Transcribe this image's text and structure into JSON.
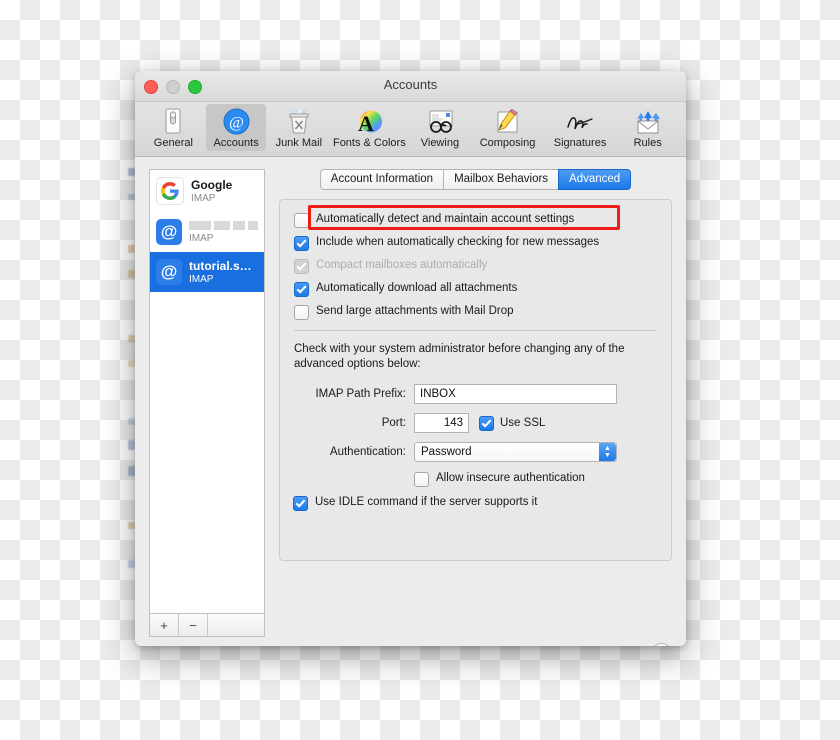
{
  "window": {
    "title": "Accounts",
    "traffic_lights": [
      "close-button",
      "minimize-button",
      "zoom-button"
    ]
  },
  "toolbar": {
    "items": [
      {
        "label": "General",
        "icon": "general-icon",
        "selected": false
      },
      {
        "label": "Accounts",
        "icon": "accounts-at-icon",
        "selected": true
      },
      {
        "label": "Junk Mail",
        "icon": "junk-mail-trash-icon",
        "selected": false
      },
      {
        "label": "Fonts & Colors",
        "icon": "fonts-colors-icon",
        "selected": false
      },
      {
        "label": "Viewing",
        "icon": "viewing-glasses-icon",
        "selected": false
      },
      {
        "label": "Composing",
        "icon": "composing-pencil-icon",
        "selected": false
      },
      {
        "label": "Signatures",
        "icon": "signatures-icon",
        "selected": false
      },
      {
        "label": "Rules",
        "icon": "rules-envelope-icon",
        "selected": false
      }
    ]
  },
  "sidebar": {
    "accounts": [
      {
        "name": "Google",
        "protocol": "IMAP",
        "icon": "google-logo-icon",
        "selected": false,
        "redacted": false
      },
      {
        "name": "",
        "protocol": "IMAP",
        "icon": "at-sign-icon",
        "selected": false,
        "redacted": true
      },
      {
        "name": "tutorial.ser...",
        "protocol": "IMAP",
        "icon": "at-sign-icon",
        "selected": true,
        "redacted": false
      }
    ],
    "add_label": "+",
    "remove_label": "−"
  },
  "tabs": [
    {
      "label": "Account Information",
      "active": false
    },
    {
      "label": "Mailbox Behaviors",
      "active": false
    },
    {
      "label": "Advanced",
      "active": true
    }
  ],
  "advanced": {
    "checkboxes": [
      {
        "label": "Automatically detect and maintain account settings",
        "checked": false,
        "disabled": false,
        "highlighted": true
      },
      {
        "label": "Include when automatically checking for new messages",
        "checked": true,
        "disabled": false,
        "highlighted": false
      },
      {
        "label": "Compact mailboxes automatically",
        "checked": true,
        "disabled": true,
        "highlighted": false
      },
      {
        "label": "Automatically download all attachments",
        "checked": true,
        "disabled": false,
        "highlighted": false
      },
      {
        "label": "Send large attachments with Mail Drop",
        "checked": false,
        "disabled": false,
        "highlighted": false
      }
    ],
    "note": "Check with your system administrator before changing any of the advanced options below:",
    "imap_path_prefix": {
      "label": "IMAP Path Prefix:",
      "value": "INBOX",
      "placeholder": ""
    },
    "port": {
      "label": "Port:",
      "value": "143",
      "placeholder": ""
    },
    "use_ssl": {
      "label": "Use SSL",
      "checked": true
    },
    "authentication": {
      "label": "Authentication:",
      "value": "Password"
    },
    "allow_insecure": {
      "label": "Allow insecure authentication",
      "checked": false
    },
    "use_idle": {
      "label": "Use IDLE command if the server supports it",
      "checked": true
    }
  },
  "footer": {
    "help_label": "?"
  },
  "colors": {
    "accent_blue": "#1b7ae8",
    "selection_blue": "#1a6fe0",
    "highlight_red": "#ee1c16",
    "window_bg": "#ececec"
  }
}
